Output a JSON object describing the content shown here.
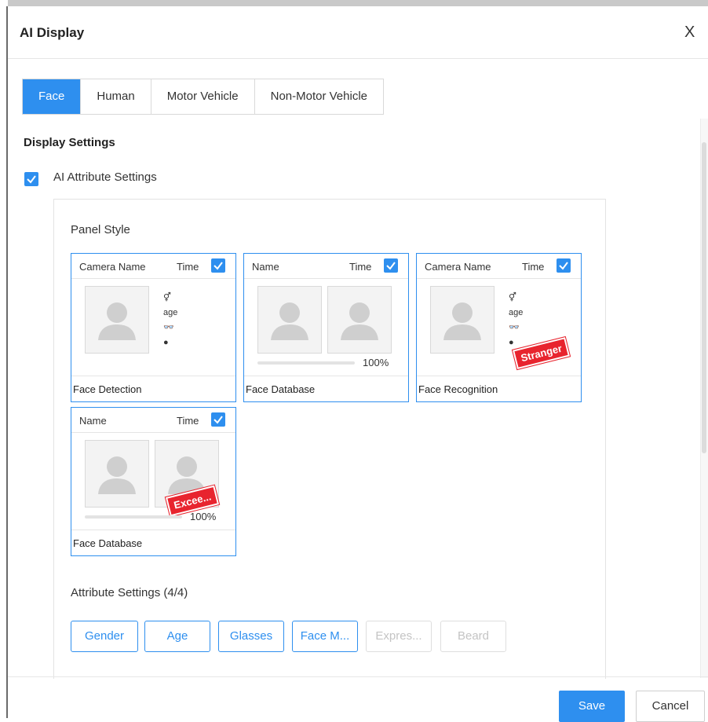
{
  "dialog": {
    "title": "AI Display",
    "close_label": "X"
  },
  "tabs": [
    {
      "label": "Face",
      "active": true
    },
    {
      "label": "Human",
      "active": false
    },
    {
      "label": "Motor Vehicle",
      "active": false
    },
    {
      "label": "Non-Motor Vehicle",
      "active": false
    }
  ],
  "display_settings": {
    "title": "Display Settings",
    "ai_attribute_label": "AI Attribute Settings",
    "ai_attribute_checked": true
  },
  "panel_style": {
    "title": "Panel Style",
    "cards": [
      {
        "name": "Camera Name",
        "time": "Time",
        "footer": "Face Detection"
      },
      {
        "name": "Name",
        "time": "Time",
        "footer": "Face Database",
        "percent": "100%"
      },
      {
        "name": "Camera Name",
        "time": "Time",
        "footer": "Face Recognition",
        "stamp": "Stranger"
      },
      {
        "name": "Name",
        "time": "Time",
        "footer": "Face Database",
        "percent": "100%",
        "stamp": "Excee..."
      }
    ],
    "attr_icons": [
      "⚥",
      "age",
      "👓",
      "●"
    ]
  },
  "attribute_settings": {
    "title": "Attribute Settings (4/4)",
    "buttons": [
      {
        "label": "Gender",
        "enabled": true
      },
      {
        "label": "Age",
        "enabled": true
      },
      {
        "label": "Glasses",
        "enabled": true
      },
      {
        "label": "Face M...",
        "enabled": true
      },
      {
        "label": "Expres...",
        "enabled": false
      },
      {
        "label": "Beard",
        "enabled": false
      }
    ]
  },
  "footer": {
    "save_label": "Save",
    "cancel_label": "Cancel"
  },
  "colors": {
    "accent": "#2e8fef",
    "stamp": "#e8242e"
  }
}
